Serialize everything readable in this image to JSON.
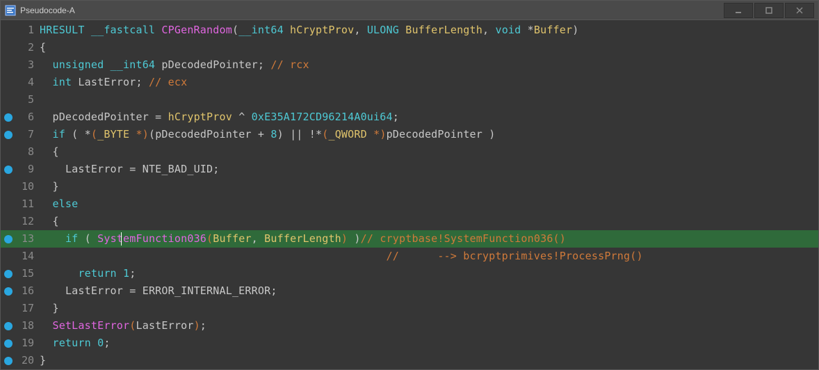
{
  "window": {
    "title": "Pseudocode-A"
  },
  "chart_data": {
    "first_line": 1,
    "highlighted_line": 13,
    "breakpoint_lines": [
      6,
      7,
      9,
      13,
      15,
      16,
      18,
      19,
      20
    ],
    "lines": [
      {
        "n": 1,
        "bp": false,
        "tokens": [
          {
            "t": "HRESULT ",
            "c": "c-type"
          },
          {
            "t": "__fastcall ",
            "c": "c-key"
          },
          {
            "t": "CPGenRandom",
            "c": "c-funcname"
          },
          {
            "t": "(",
            "c": "c-punct"
          },
          {
            "t": "__int64 ",
            "c": "c-key"
          },
          {
            "t": "hCryptProv",
            "c": "c-param"
          },
          {
            "t": ", ",
            "c": "c-punct"
          },
          {
            "t": "ULONG ",
            "c": "c-type"
          },
          {
            "t": "BufferLength",
            "c": "c-param"
          },
          {
            "t": ", ",
            "c": "c-punct"
          },
          {
            "t": "void ",
            "c": "c-key"
          },
          {
            "t": "*",
            "c": "c-punct"
          },
          {
            "t": "Buffer",
            "c": "c-param"
          },
          {
            "t": ")",
            "c": "c-punct"
          }
        ]
      },
      {
        "n": 2,
        "bp": false,
        "tokens": [
          {
            "t": "{",
            "c": "c-punct"
          }
        ]
      },
      {
        "n": 3,
        "bp": false,
        "tokens": [
          {
            "t": "  ",
            "c": "c-punct"
          },
          {
            "t": "unsigned __int64 ",
            "c": "c-key"
          },
          {
            "t": "pDecodedPointer",
            "c": "c-ident"
          },
          {
            "t": "; ",
            "c": "c-punct"
          },
          {
            "t": "// rcx",
            "c": "c-comment"
          }
        ]
      },
      {
        "n": 4,
        "bp": false,
        "tokens": [
          {
            "t": "  ",
            "c": "c-punct"
          },
          {
            "t": "int ",
            "c": "c-key"
          },
          {
            "t": "LastError",
            "c": "c-ident"
          },
          {
            "t": "; ",
            "c": "c-punct"
          },
          {
            "t": "// ecx",
            "c": "c-comment"
          }
        ]
      },
      {
        "n": 5,
        "bp": false,
        "tokens": [
          {
            "t": "",
            "c": "c-punct"
          }
        ]
      },
      {
        "n": 6,
        "bp": true,
        "tokens": [
          {
            "t": "  ",
            "c": "c-punct"
          },
          {
            "t": "pDecodedPointer ",
            "c": "c-ident"
          },
          {
            "t": "= ",
            "c": "c-punct"
          },
          {
            "t": "hCryptProv ",
            "c": "c-param"
          },
          {
            "t": "^ ",
            "c": "c-punct"
          },
          {
            "t": "0xE35A172CD96214A0ui64",
            "c": "c-hex"
          },
          {
            "t": ";",
            "c": "c-punct"
          }
        ]
      },
      {
        "n": 7,
        "bp": true,
        "tokens": [
          {
            "t": "  ",
            "c": "c-punct"
          },
          {
            "t": "if ",
            "c": "c-key"
          },
          {
            "t": "( *",
            "c": "c-punct"
          },
          {
            "t": "(",
            "c": "c-orange"
          },
          {
            "t": "_BYTE ",
            "c": "c-macro"
          },
          {
            "t": "*",
            "c": "c-orange"
          },
          {
            "t": ")",
            "c": "c-orange"
          },
          {
            "t": "(",
            "c": "c-punct"
          },
          {
            "t": "pDecodedPointer ",
            "c": "c-ident"
          },
          {
            "t": "+ ",
            "c": "c-punct"
          },
          {
            "t": "8",
            "c": "c-num"
          },
          {
            "t": ") || !*",
            "c": "c-punct"
          },
          {
            "t": "(",
            "c": "c-orange"
          },
          {
            "t": "_QWORD ",
            "c": "c-macro"
          },
          {
            "t": "*",
            "c": "c-orange"
          },
          {
            "t": ")",
            "c": "c-orange"
          },
          {
            "t": "pDecodedPointer ",
            "c": "c-ident"
          },
          {
            "t": ")",
            "c": "c-punct"
          }
        ]
      },
      {
        "n": 8,
        "bp": false,
        "tokens": [
          {
            "t": "  {",
            "c": "c-punct"
          }
        ]
      },
      {
        "n": 9,
        "bp": true,
        "tokens": [
          {
            "t": "    ",
            "c": "c-punct"
          },
          {
            "t": "LastError ",
            "c": "c-ident"
          },
          {
            "t": "= ",
            "c": "c-punct"
          },
          {
            "t": "NTE_BAD_UID",
            "c": "c-const"
          },
          {
            "t": ";",
            "c": "c-punct"
          }
        ]
      },
      {
        "n": 10,
        "bp": false,
        "tokens": [
          {
            "t": "  }",
            "c": "c-punct"
          }
        ]
      },
      {
        "n": 11,
        "bp": false,
        "tokens": [
          {
            "t": "  ",
            "c": "c-punct"
          },
          {
            "t": "else",
            "c": "c-key"
          }
        ]
      },
      {
        "n": 12,
        "bp": false,
        "tokens": [
          {
            "t": "  {",
            "c": "c-punct"
          }
        ]
      },
      {
        "n": 13,
        "bp": true,
        "hl": true,
        "caret_before": "    if ( Syst",
        "tokens": [
          {
            "t": "    ",
            "c": "c-punct"
          },
          {
            "t": "if ",
            "c": "c-key"
          },
          {
            "t": "( ",
            "c": "c-punct"
          },
          {
            "t": "SystemFunction036",
            "c": "c-func"
          },
          {
            "t": "(",
            "c": "c-orange"
          },
          {
            "t": "Buffer",
            "c": "c-param"
          },
          {
            "t": ", ",
            "c": "c-punct"
          },
          {
            "t": "BufferLength",
            "c": "c-param"
          },
          {
            "t": ")",
            "c": "c-orange"
          },
          {
            "t": " )",
            "c": "c-punct"
          },
          {
            "t": "// cryptbase!SystemFunction036()",
            "c": "c-comment"
          }
        ]
      },
      {
        "n": 14,
        "bp": false,
        "tokens": [
          {
            "t": "                                                      ",
            "c": "c-punct"
          },
          {
            "t": "//      --> bcryptprimives!ProcessPrng()",
            "c": "c-comment"
          }
        ]
      },
      {
        "n": 15,
        "bp": true,
        "tokens": [
          {
            "t": "      ",
            "c": "c-punct"
          },
          {
            "t": "return ",
            "c": "c-key"
          },
          {
            "t": "1",
            "c": "c-num"
          },
          {
            "t": ";",
            "c": "c-punct"
          }
        ]
      },
      {
        "n": 16,
        "bp": true,
        "tokens": [
          {
            "t": "    ",
            "c": "c-punct"
          },
          {
            "t": "LastError ",
            "c": "c-ident"
          },
          {
            "t": "= ",
            "c": "c-punct"
          },
          {
            "t": "ERROR_INTERNAL_ERROR",
            "c": "c-const"
          },
          {
            "t": ";",
            "c": "c-punct"
          }
        ]
      },
      {
        "n": 17,
        "bp": false,
        "tokens": [
          {
            "t": "  }",
            "c": "c-punct"
          }
        ]
      },
      {
        "n": 18,
        "bp": true,
        "tokens": [
          {
            "t": "  ",
            "c": "c-punct"
          },
          {
            "t": "SetLastError",
            "c": "c-func"
          },
          {
            "t": "(",
            "c": "c-orange"
          },
          {
            "t": "LastError",
            "c": "c-ident"
          },
          {
            "t": ")",
            "c": "c-orange"
          },
          {
            "t": ";",
            "c": "c-punct"
          }
        ]
      },
      {
        "n": 19,
        "bp": true,
        "tokens": [
          {
            "t": "  ",
            "c": "c-punct"
          },
          {
            "t": "return ",
            "c": "c-key"
          },
          {
            "t": "0",
            "c": "c-num"
          },
          {
            "t": ";",
            "c": "c-punct"
          }
        ]
      },
      {
        "n": 20,
        "bp": true,
        "tokens": [
          {
            "t": "}",
            "c": "c-punct"
          }
        ]
      }
    ]
  }
}
